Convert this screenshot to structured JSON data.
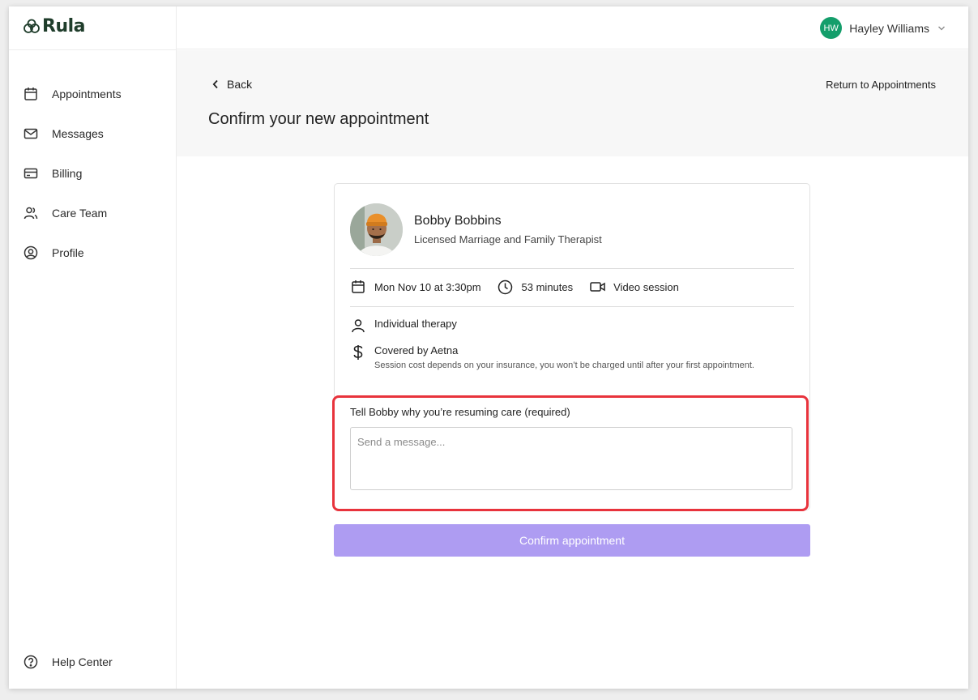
{
  "app": {
    "logo_text": "Rula",
    "brand_color": "#1f3d2b",
    "accent_color": "#ae9cf2"
  },
  "sidebar": {
    "items": [
      {
        "label": "Appointments",
        "icon": "calendar-icon"
      },
      {
        "label": "Messages",
        "icon": "mail-icon"
      },
      {
        "label": "Billing",
        "icon": "credit-card-icon"
      },
      {
        "label": "Care Team",
        "icon": "people-icon"
      },
      {
        "label": "Profile",
        "icon": "user-circle-icon"
      }
    ],
    "help_label": "Help Center"
  },
  "user": {
    "initials": "HW",
    "name": "Hayley Williams",
    "avatar_color": "#149e6b"
  },
  "header": {
    "back_label": "Back",
    "return_label": "Return to Appointments",
    "title": "Confirm your new appointment"
  },
  "card": {
    "therapist_name": "Bobby Bobbins",
    "therapist_role": "Licensed Marriage and Family Therapist",
    "date_time": "Mon Nov 10 at 3:30pm",
    "duration": "53 minutes",
    "session_type": "Video session",
    "therapy_type": "Individual therapy",
    "coverage": "Covered by Aetna",
    "coverage_note": "Session cost depends on your insurance, you won’t be charged until after your first appointment.",
    "message_label": "Tell Bobby why you’re resuming care (required)",
    "message_placeholder": "Send a message...",
    "message_value": ""
  },
  "confirm_label": "Confirm appointment"
}
